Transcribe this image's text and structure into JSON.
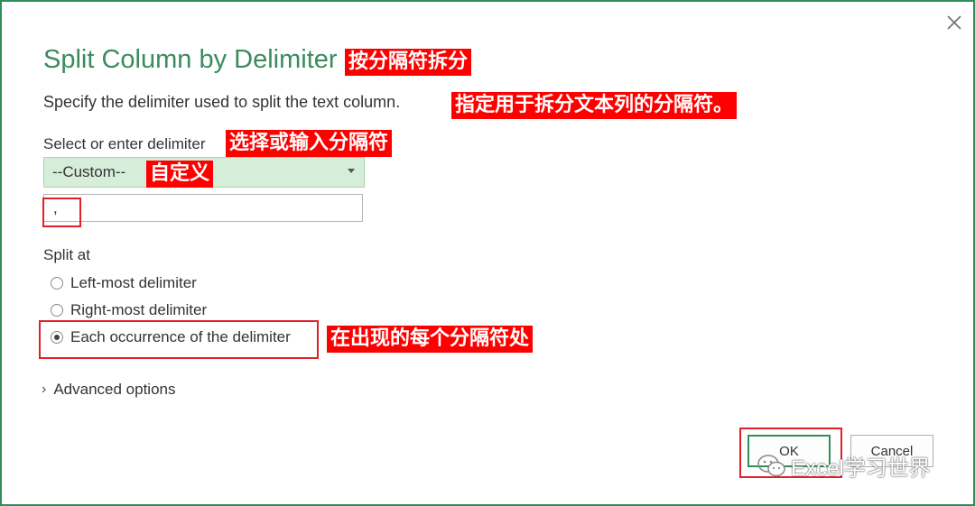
{
  "dialog": {
    "title": "Split Column by Delimiter",
    "title_annotation": "按分隔符拆分",
    "description": "Specify the delimiter used to split the text column.",
    "description_annotation": "指定用于拆分文本列的分隔符。",
    "delimiter_label": "Select or enter delimiter",
    "delimiter_label_annotation": "选择或输入分隔符",
    "delimiter_selected": "--Custom--",
    "delimiter_selected_annotation": "自定义",
    "custom_value": ",",
    "split_at_label": "Split at",
    "split_options": [
      {
        "label": "Left-most delimiter",
        "checked": false
      },
      {
        "label": "Right-most delimiter",
        "checked": false
      },
      {
        "label": "Each occurrence of the delimiter",
        "checked": true
      }
    ],
    "split_option_annotation": "在出现的每个分隔符处",
    "advanced_label": "Advanced options",
    "ok_label": "OK",
    "cancel_label": "Cancel"
  },
  "watermark": {
    "text": "Excel学习世界"
  },
  "icons": {
    "close": "close-icon",
    "dropdown": "chevron-down-icon",
    "expand": "chevron-right-icon",
    "watermark": "wechat-icon"
  },
  "colors": {
    "accent": "#3a8b5d",
    "annotation": "#ff0000",
    "dropdown_bg": "#d6eed9"
  }
}
